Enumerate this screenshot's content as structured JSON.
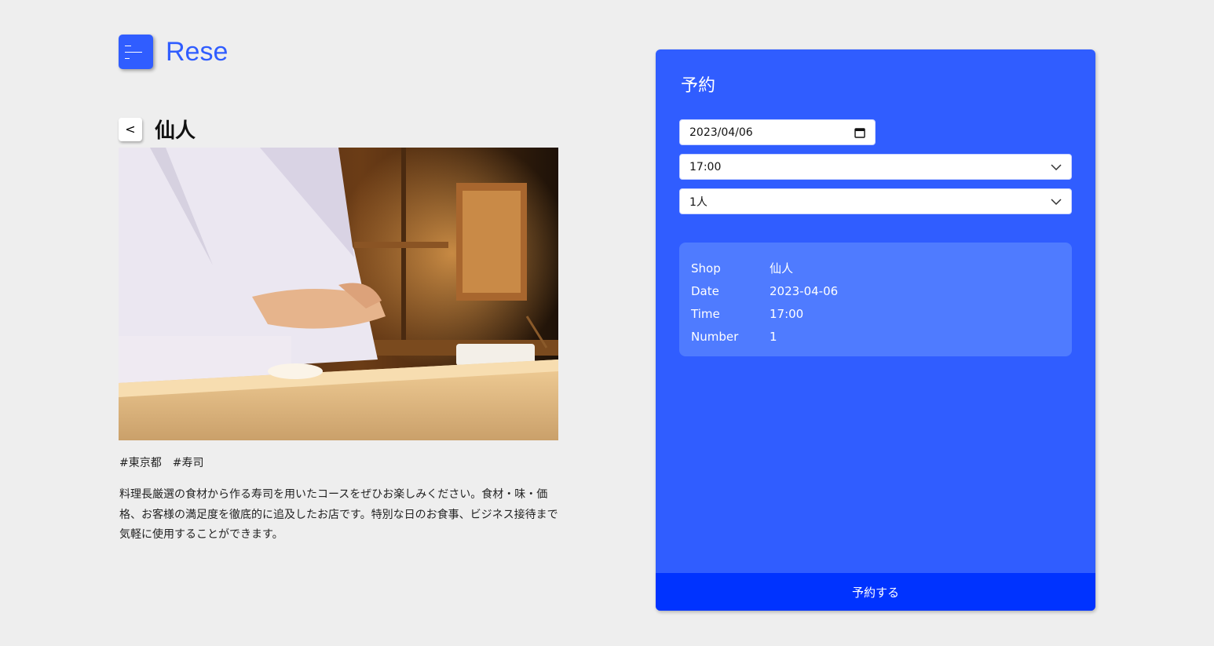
{
  "header": {
    "logo_text": "Rese"
  },
  "shop": {
    "back_label": "<",
    "name": "仙人",
    "tags": [
      "#東京都",
      "#寿司"
    ],
    "description": "料理長厳選の食材から作る寿司を用いたコースをぜひお楽しみください。食材・味・価格、お客様の満足度を徹底的に追及したお店です。特別な日のお食事、ビジネス接待まで気軽に使用することができます。"
  },
  "reservation": {
    "title": "予約",
    "date_value": "2023/04/06",
    "time_value": "17:00",
    "number_value": "1人",
    "summary": {
      "shop_label": "Shop",
      "shop_value": "仙人",
      "date_label": "Date",
      "date_value": "2023-04-06",
      "time_label": "Time",
      "time_value": "17:00",
      "number_label": "Number",
      "number_value": "1"
    },
    "submit_label": "予約する"
  },
  "colors": {
    "accent": "#305dff",
    "summary_bg": "#4f7bff",
    "submit_bg": "#0033ff",
    "page_bg": "#eeeeee"
  },
  "icons": [
    "menu-icon",
    "calendar-icon",
    "chevron-down-icon"
  ]
}
